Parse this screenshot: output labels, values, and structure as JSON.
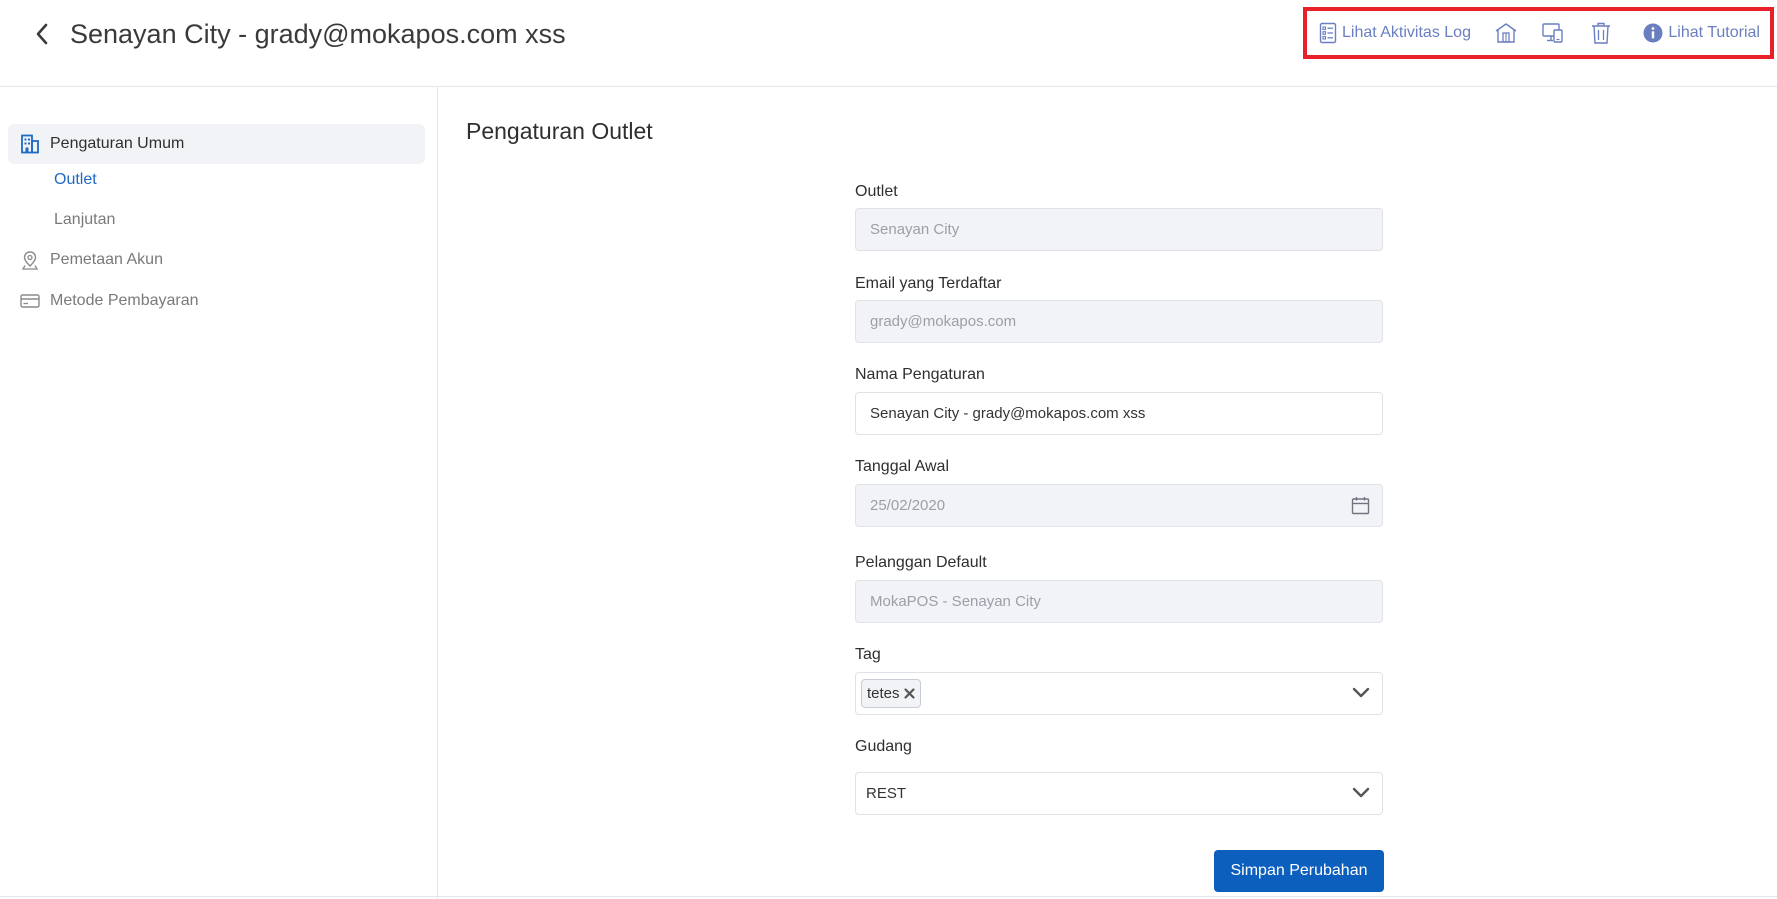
{
  "header": {
    "title": "Senayan City - grady@mokapos.com xss"
  },
  "toolbar": {
    "activity_log_label": "Lihat Aktivitas Log",
    "tutorial_label": "Lihat Tutorial",
    "icons": [
      "activity-log-icon",
      "outlet-building-icon",
      "device-icon",
      "trash-icon",
      "info-icon"
    ],
    "color": "#6a7fc0",
    "highlight_color": "#e8202a"
  },
  "sidebar": {
    "group_general": "Pengaturan Umum",
    "sub_outlet": "Outlet",
    "sub_advanced": "Lanjutan",
    "account_mapping": "Pemetaan Akun",
    "payment_method": "Metode Pembayaran",
    "active_color": "#1f6bc4"
  },
  "main": {
    "section_title": "Pengaturan Outlet",
    "fields": {
      "outlet": {
        "label": "Outlet",
        "value": "Senayan City"
      },
      "email": {
        "label": "Email yang Terdaftar",
        "value": "grady@mokapos.com"
      },
      "setting_name": {
        "label": "Nama Pengaturan",
        "value": "Senayan City - grady@mokapos.com xss"
      },
      "start_date": {
        "label": "Tanggal Awal",
        "value": "25/02/2020"
      },
      "default_customer": {
        "label": "Pelanggan Default",
        "value": "MokaPOS - Senayan City"
      },
      "tag": {
        "label": "Tag",
        "chip": "tetes"
      },
      "warehouse": {
        "label": "Gudang",
        "value": "REST"
      }
    },
    "save_label": "Simpan Perubahan",
    "primary_color": "#0d5fbd"
  }
}
